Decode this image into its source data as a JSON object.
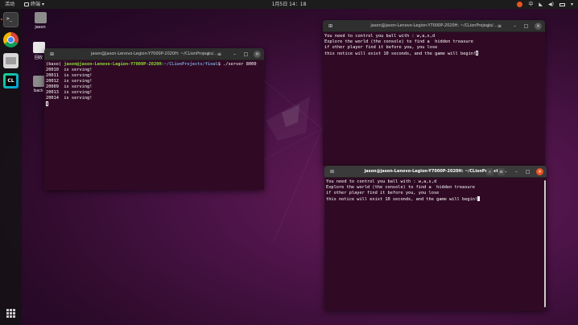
{
  "topbar": {
    "activities": "活动",
    "app_menu": "终端",
    "clock": "1月5日  14：18",
    "input_method": "中"
  },
  "desktop": {
    "icons": [
      {
        "label": "jason"
      },
      {
        "label": "回收"
      },
      {
        "label": "back"
      }
    ]
  },
  "terminals": [
    {
      "title": "jason@jason-Lenovo-Legion-Y7000P-2020H: ~/CLionProjects/...",
      "prompt_prefix": "(base) ",
      "prompt_user": "jason@jason-Lenovo-Legion-Y7000P-2020H",
      "prompt_path": ":~/CLionProjects/final",
      "command": "$ ./server 8000",
      "lines": [
        "20010  is serving!",
        "20011  is serving!",
        "20012  is serving!",
        "20009  is serving!",
        "20013  is serving!",
        "20014  is serving!"
      ]
    },
    {
      "title": "jason@jason-Lenovo-Legion-Y7000P-2020H: ~/CLionProjects/...",
      "lines": [
        "You need to control you ball with : w,a,s,d",
        "Explore the world (the console) to find a  hidden treasure",
        "if other player find it before you, you lose",
        "this notice will exist 10 seconds, and the game will begin!"
      ]
    },
    {
      "title": "jason@jason-Lenovo-Legion-Y7000P-2020H: ~/CLionProjects/...",
      "lines": [
        "You need to control you ball with : w,a,s,d",
        "Explore the world (the console) to find a  hidden treasure",
        "if other player find it before you, you lose",
        "this notice will exist 10 seconds, and the game will begin!"
      ]
    }
  ],
  "colors": {
    "terminal_bg": "#300a24",
    "accent": "#e95420",
    "prompt_user": "#8ae234",
    "prompt_path": "#729fcf"
  }
}
